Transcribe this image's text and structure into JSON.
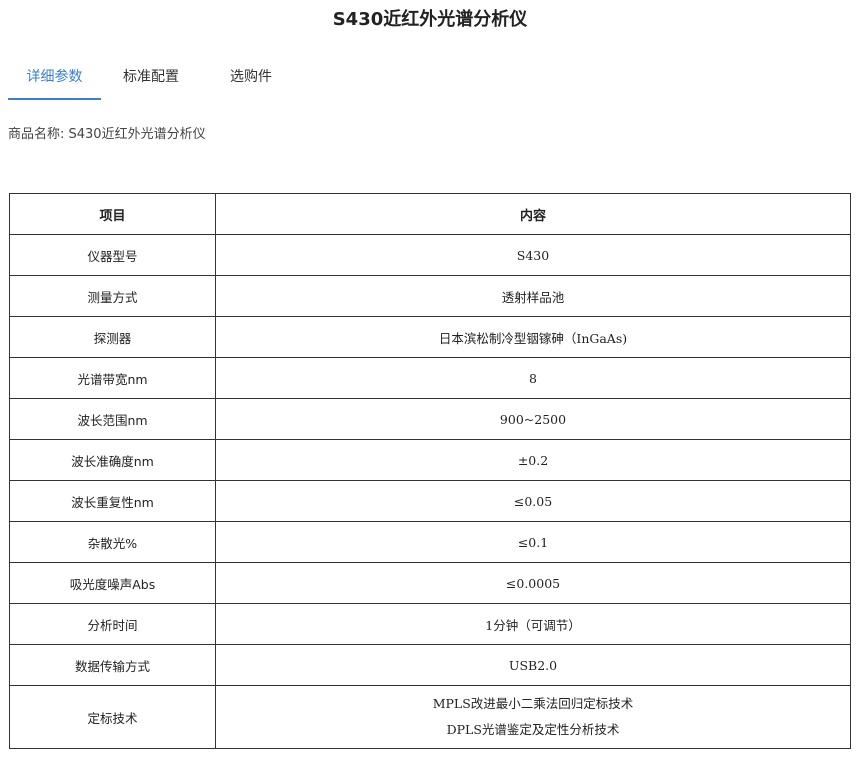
{
  "page": {
    "title": "S430近红外光谱分析仪"
  },
  "tabs": [
    {
      "label": "详细参数",
      "active": true
    },
    {
      "label": "标准配置",
      "active": false
    },
    {
      "label": "选购件",
      "active": false
    }
  ],
  "product": {
    "name_line": "商品名称: S430近红外光谱分析仪"
  },
  "table": {
    "headers": [
      "项目",
      "内容"
    ],
    "rows": [
      {
        "item": "仪器型号",
        "content": "S430"
      },
      {
        "item": "测量方式",
        "content": "透射样品池"
      },
      {
        "item": "探测器",
        "content": "日本滨松制冷型铟镓砷（InGaAs)"
      },
      {
        "item": "光谱带宽nm",
        "content": "8"
      },
      {
        "item": "波长范围nm",
        "content": "900~2500"
      },
      {
        "item": "波长准确度nm",
        "content": "±0.2"
      },
      {
        "item": "波长重复性nm",
        "content": "≤0.05"
      },
      {
        "item": "杂散光%",
        "content": "≤0.1"
      },
      {
        "item": "吸光度噪声Abs",
        "content": "≤0.0005"
      },
      {
        "item": "分析时间",
        "content": "1分钟（可调节）"
      },
      {
        "item": "数据传输方式",
        "content": "USB2.0"
      },
      {
        "item": "定标技术",
        "content_lines": [
          "MPLS改进最小二乘法回归定标技术",
          "DPLS光谱鉴定及定性分析技术"
        ]
      }
    ]
  },
  "colors": {
    "accent": "#3a7fd5",
    "border": "#333333",
    "text": "#333333"
  }
}
